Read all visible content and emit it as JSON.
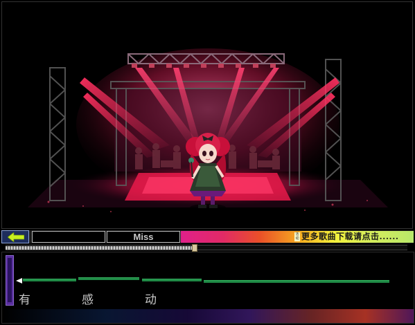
{
  "hud": {
    "score": "",
    "judgement": "Miss",
    "ad_badge": "活动",
    "ad_text": "更多歌曲下载请点击......"
  },
  "playback": {
    "progress": 0.47
  },
  "lyrics": {
    "chars": [
      "有",
      "感",
      "动"
    ]
  },
  "colors": {
    "stage_light": "#ff2a5a",
    "note_bar": "#1f8a46",
    "pitch_meter": "#5a2ea0",
    "back_button": "#1d2d5c"
  },
  "icons": {
    "back": "arrow-left-icon"
  }
}
